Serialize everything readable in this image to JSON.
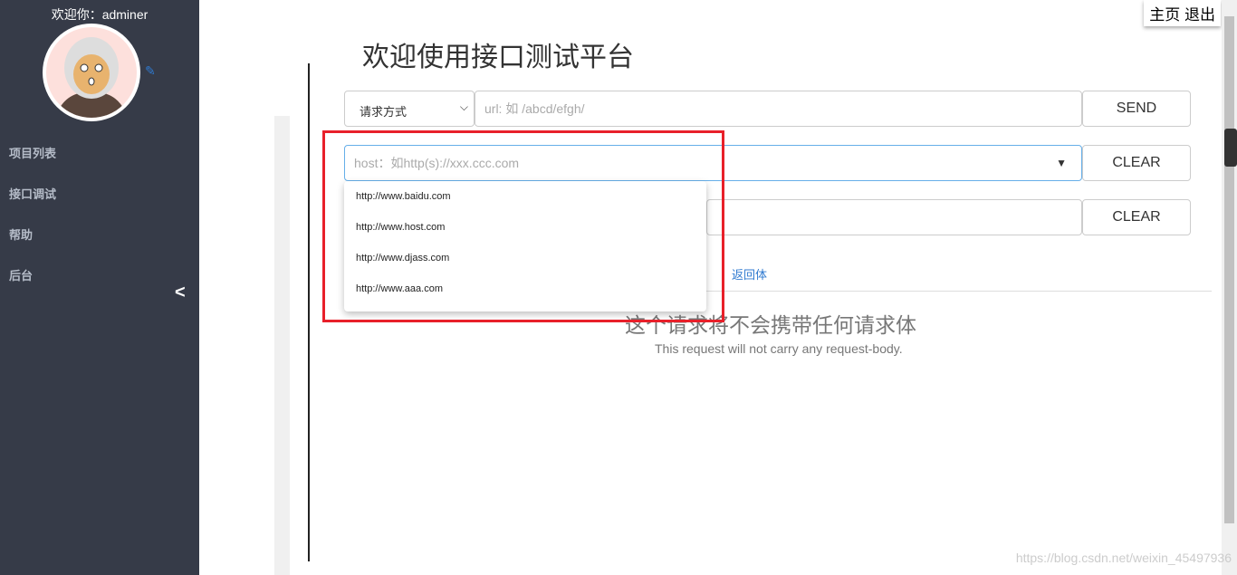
{
  "sidebar": {
    "welcome": "欢迎你：adminer",
    "items": [
      {
        "label": "项目列表"
      },
      {
        "label": "接口调试"
      },
      {
        "label": "帮助"
      },
      {
        "label": "后台"
      }
    ],
    "collapse": "<"
  },
  "topnav": {
    "home": "主页",
    "logout": "退出"
  },
  "main": {
    "title": "欢迎使用接口测试平台",
    "method_select": {
      "value": "请求方式"
    },
    "url_input": {
      "placeholder": "url: 如 /abcd/efgh/"
    },
    "host_input": {
      "placeholder": "host：如http(s)://xxx.ccc.com"
    },
    "send": "SEND",
    "clear1": "CLEAR",
    "clear2": "CLEAR",
    "tab_response": "返回体",
    "empty_title": "这个请求将不会携带任何请求体",
    "empty_sub": "This request will not carry any request-body.",
    "host_options": [
      "http://www.baidu.com",
      "http://www.host.com",
      "http://www.djass.com",
      "http://www.aaa.com"
    ]
  },
  "watermark": "https://blog.csdn.net/weixin_45497936",
  "colors": {
    "sidebar": "#363b48",
    "highlight": "#e8202a",
    "link": "#2f7ad0"
  }
}
